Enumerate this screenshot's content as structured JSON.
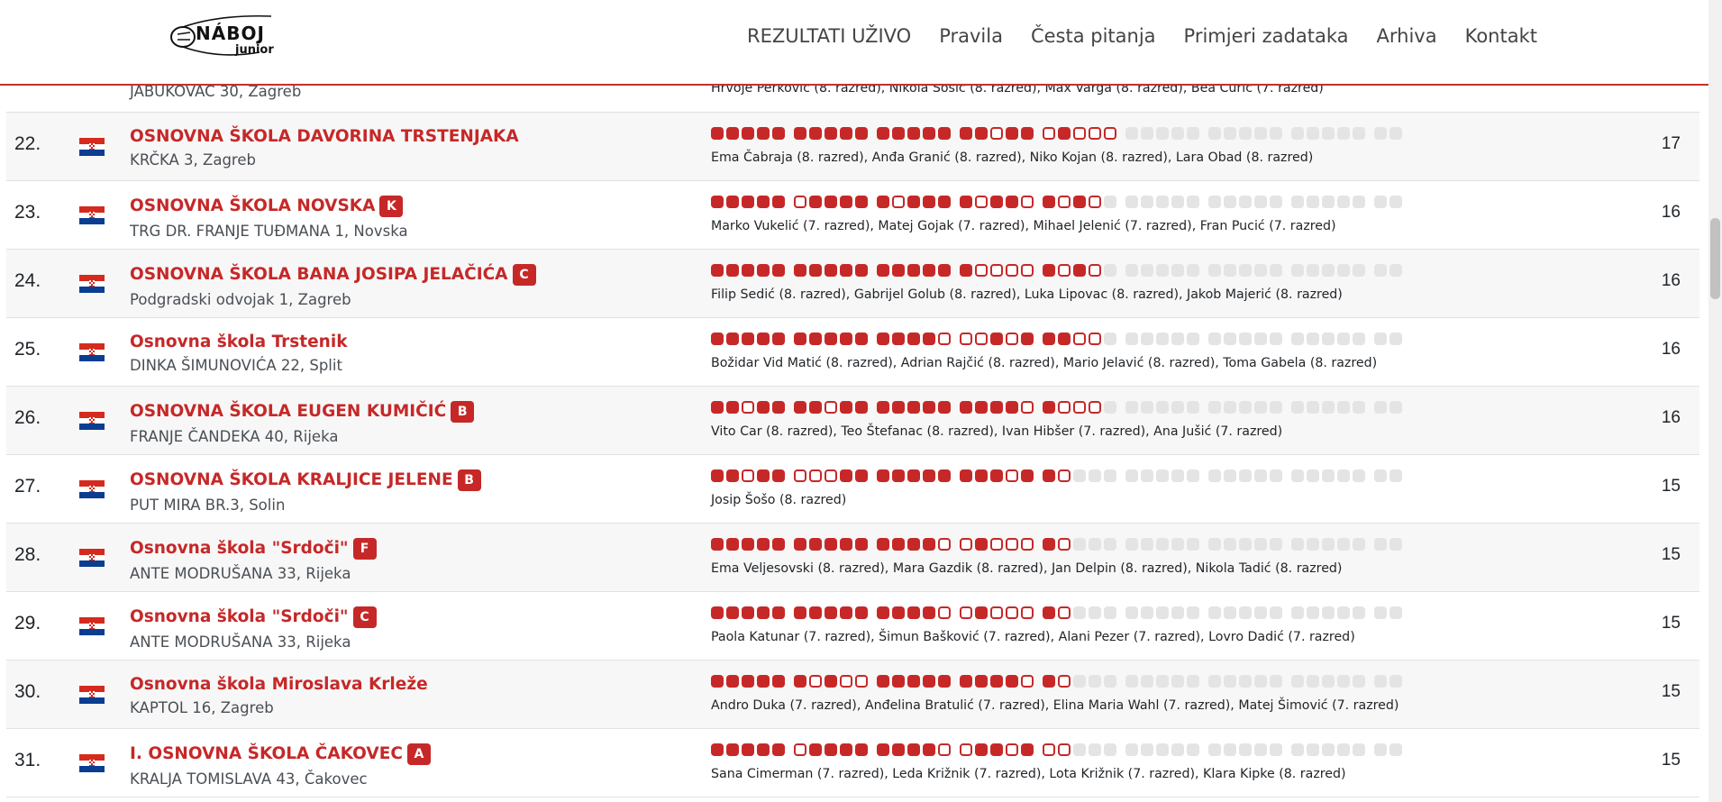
{
  "header": {
    "logo_word": "NÁBOJ",
    "logo_sub": "junior",
    "nav": [
      "REZULTATI UŽIVO",
      "Pravila",
      "Česta pitanja",
      "Primjeri zadataka",
      "Arhiva",
      "Kontakt"
    ]
  },
  "partial_row": {
    "address": "JABUKOVAC 30, Zagreb",
    "members": "Hrvoje Perković (8. razred), Nikola Šošić (8. razred), Max Varga (8. razred), Bea Ćurić (7. razred)"
  },
  "rows": [
    {
      "rank": "22.",
      "name": "OSNOVNA ŠKOLA DAVORINA TRSTENJAKA",
      "badge": "",
      "address": "KRČKA 3, Zagreb",
      "problems": "SSSSSSSSSSSSSSSSSOSSOSOOO",
      "members": "Ema Čabraja (8. razred), Anđa Granić (8. razred), Niko Kojan (8. razred), Lara Obad (8. razred)",
      "score": "17"
    },
    {
      "rank": "23.",
      "name": "OSNOVNA ŠKOLA NOVSKA",
      "badge": "K",
      "address": "TRG DR. FRANJE TUĐMANA 1, Novska",
      "problems": "SSSSSOSSSSSOSSSSOSSOSOSO",
      "members": "Marko Vukelić (7. razred), Matej Gojak (7. razred), Mihael Jelenić (7. razred), Fran Pucić (7. razred)",
      "score": "16"
    },
    {
      "rank": "24.",
      "name": "OSNOVNA ŠKOLA BANA JOSIPA JELAČIĆA",
      "badge": "C",
      "address": "Podgradski odvojak 1, Zagreb",
      "problems": "SSSSSSSSSSSSSSSSOOOOSOSO",
      "members": "Filip Sedić (8. razred), Gabrijel Golub (8. razred), Luka Lipovac (8. razred), Jakob Majerić (8. razred)",
      "score": "16"
    },
    {
      "rank": "25.",
      "name": "Osnovna škola Trstenik",
      "badge": "",
      "address": "DINKA ŠIMUNOVIĆA 22, Split",
      "problems": "SSSSSSSSSSSSSSOOOSOSSSOO",
      "members": "Božidar Vid Matić (8. razred), Adrian Rajčić (8. razred), Mario Jelavić (8. razred), Toma Gabela (8. razred)",
      "score": "16"
    },
    {
      "rank": "26.",
      "name": "OSNOVNA ŠKOLA EUGEN KUMIČIĆ",
      "badge": "B",
      "address": "FRANJE ČANDEKA 40, Rijeka",
      "problems": "SSOSSSSOSSSSSSSSSSSOSOOO",
      "members": "Vito Car (8. razred), Teo Štefanac (8. razred), Ivan Hibšer (7. razred), Ana Jušić (7. razred)",
      "score": "16"
    },
    {
      "rank": "27.",
      "name": "OSNOVNA ŠKOLA KRALJICE JELENE",
      "badge": "B",
      "address": "PUT MIRA BR.3, Solin",
      "problems": "SSOSSOOOSSSSSSSSSSOSSO",
      "members": "Josip Šošo (8. razred)",
      "score": "15"
    },
    {
      "rank": "28.",
      "name": "Osnovna škola \"Srdoči\"",
      "badge": "F",
      "address": "ANTE MODRUŠANA 33, Rijeka",
      "problems": "SSSSSSSSSSSSSSOOSOOOSO",
      "members": "Ema Veljesovski (8. razred), Mara Gazdik (8. razred), Jan Delpin (8. razred), Nikola Tadić (8. razred)",
      "score": "15"
    },
    {
      "rank": "29.",
      "name": "Osnovna škola \"Srdoči\"",
      "badge": "C",
      "address": "ANTE MODRUŠANA 33, Rijeka",
      "problems": "SSSSSSSSSSSSSSOOSOOOSO",
      "members": "Paola Katunar (7. razred), Šimun Bašković (7. razred), Alani Pezer (7. razred), Lovro Dadić (7. razred)",
      "score": "15"
    },
    {
      "rank": "30.",
      "name": "Osnovna škola Miroslava Krleže",
      "badge": "",
      "address": "KAPTOL 16, Zagreb",
      "problems": "SSSSSSOSOOSSSSSSSSSOSO",
      "members": "Andro Duka (7. razred), Anđelina Bratulić (7. razred), Elina Maria Wahl (7. razred), Matej Šimović (7. razred)",
      "score": "15"
    },
    {
      "rank": "31.",
      "name": "I. OSNOVNA ŠKOLA ČAKOVEC",
      "badge": "A",
      "address": "KRALJA TOMISLAVA 43, Čakovec",
      "problems": "SSSSSOSSSSSSSSOOSSOSOO",
      "members": "Sana Cimerman (7. razred), Leda Križnik (7. razred), Lota Križnik (7. razred), Klara Kipke (8. razred)",
      "score": "15"
    }
  ],
  "colors": {
    "accent": "#c62828",
    "empty": "#e4e4e4",
    "header_rule": "#c9302c"
  }
}
